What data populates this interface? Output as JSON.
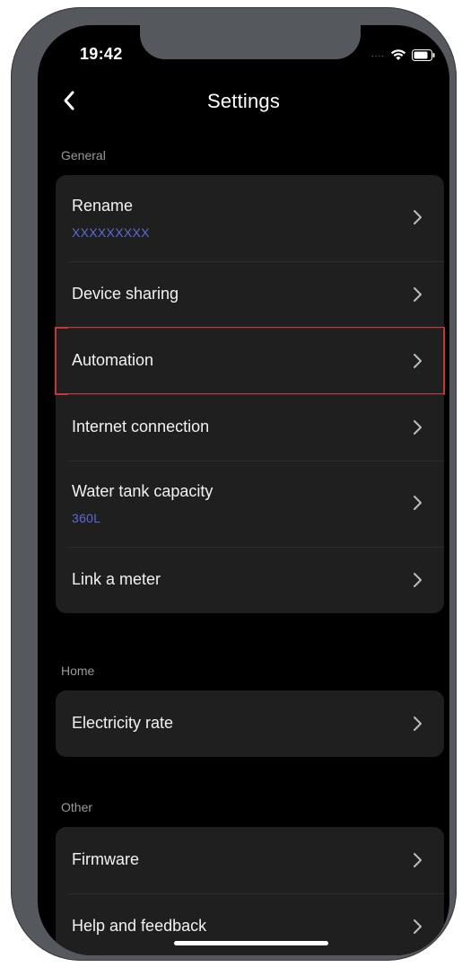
{
  "status_bar": {
    "time": "19:42",
    "signal_dots": "....",
    "wifi_icon": "wifi-icon",
    "battery_icon": "battery-icon"
  },
  "header": {
    "back_icon": "chevron-left-icon",
    "title": "Settings"
  },
  "sections": {
    "general": {
      "title": "General",
      "rename": {
        "label": "Rename",
        "value": "XXXXXXXXX"
      },
      "device_sharing": {
        "label": "Device sharing"
      },
      "automation": {
        "label": "Automation",
        "highlighted": true
      },
      "internet_connection": {
        "label": "Internet connection"
      },
      "water_tank_capacity": {
        "label": "Water tank capacity",
        "value": "360L"
      },
      "link_meter": {
        "label": "Link a meter"
      }
    },
    "home": {
      "title": "Home",
      "electricity_rate": {
        "label": "Electricity rate"
      }
    },
    "other": {
      "title": "Other",
      "firmware": {
        "label": "Firmware"
      },
      "help_feedback": {
        "label": "Help and feedback"
      }
    }
  },
  "colors": {
    "background": "#000000",
    "card": "#1f1f1f",
    "section_header": "#9a9a9a",
    "subtext_accent": "#5b6bd6",
    "highlight_outline": "#c9343a",
    "frame": "#55585c"
  }
}
